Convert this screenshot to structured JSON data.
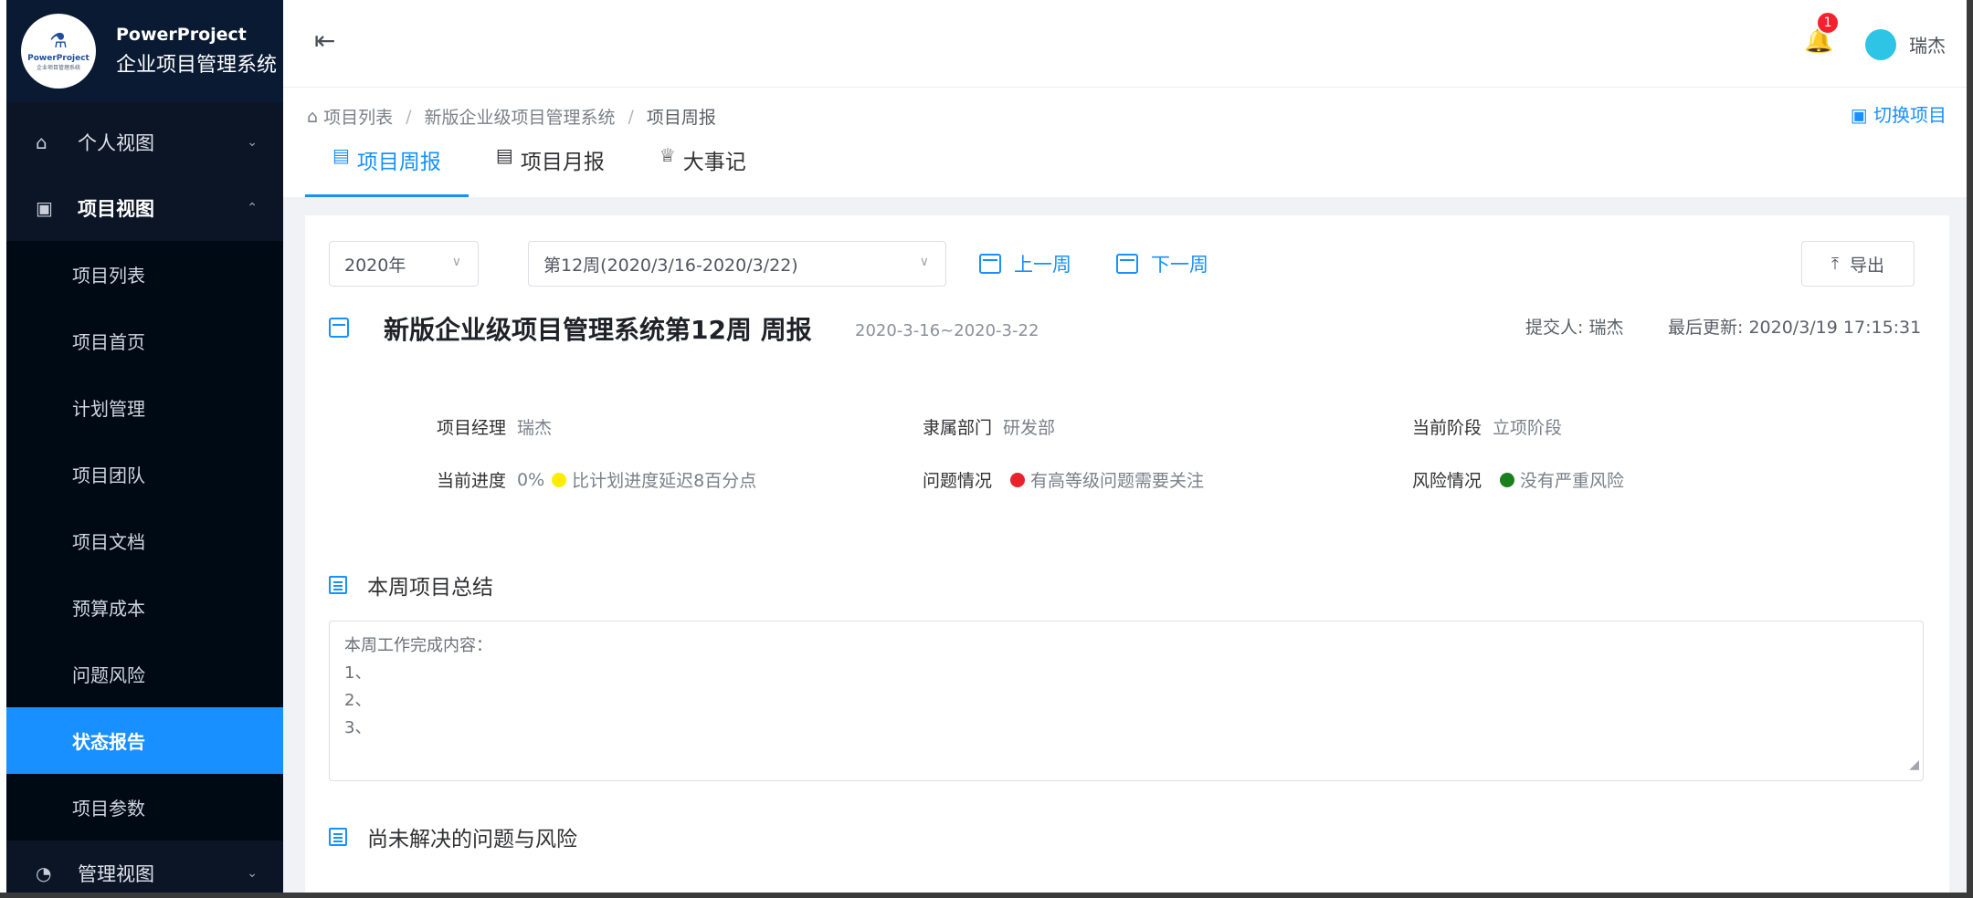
{
  "brand": {
    "logo_text": "PowerProject",
    "logo_subtext": "企业项目管理系统",
    "name": "PowerProject",
    "subtitle": "企业项目管理系统"
  },
  "sidebar": {
    "groups": [
      {
        "label": "个人视图",
        "icon": "home-icon",
        "expanded": false
      },
      {
        "label": "项目视图",
        "icon": "project-view-icon",
        "expanded": true
      },
      {
        "label": "管理视图",
        "icon": "dashboard-icon",
        "expanded": false
      }
    ],
    "items": [
      {
        "label": "项目列表"
      },
      {
        "label": "项目首页"
      },
      {
        "label": "计划管理"
      },
      {
        "label": "项目团队"
      },
      {
        "label": "项目文档"
      },
      {
        "label": "预算成本"
      },
      {
        "label": "问题风险"
      },
      {
        "label": "状态报告",
        "active": true
      },
      {
        "label": "项目参数"
      }
    ]
  },
  "header": {
    "notification_count": "1",
    "username": "瑞杰"
  },
  "breadcrumb": {
    "items": [
      "项目列表",
      "新版企业级项目管理系统",
      "项目周报"
    ],
    "switch_label": "切换项目"
  },
  "tabs": [
    {
      "label": "项目周报",
      "active": true
    },
    {
      "label": "项目月报"
    },
    {
      "label": "大事记"
    }
  ],
  "toolbar": {
    "year_value": "2020年",
    "week_value": "第12周(2020/3/16-2020/3/22)",
    "prev_week": "上一周",
    "next_week": "下一周",
    "export_label": "导出"
  },
  "report": {
    "title": "新版企业级项目管理系统第12周 周报",
    "range": "2020-3-16~2020-3-22",
    "submitter": "提交人: 瑞杰",
    "updated": "最后更新: 2020/3/19 17:15:31"
  },
  "info": {
    "manager_label": "项目经理",
    "manager_value": "瑞杰",
    "dept_label": "隶属部门",
    "dept_value": "研发部",
    "stage_label": "当前阶段",
    "stage_value": "立项阶段",
    "progress_label": "当前进度",
    "progress_value": "0%",
    "progress_note": "比计划进度延迟8百分点",
    "issue_label": "问题情况",
    "issue_note": "有高等级问题需要关注",
    "risk_label": "风险情况",
    "risk_note": "没有严重风险"
  },
  "status_colors": {
    "progress": "#ffec00",
    "issue": "#e8232b",
    "risk": "#1a7f1e"
  },
  "sections": {
    "summary_title": "本周项目总结",
    "summary_lines": [
      "本周工作完成内容：",
      "1、",
      "2、",
      "3、"
    ],
    "issues_title": "尚未解决的问题与风险"
  }
}
